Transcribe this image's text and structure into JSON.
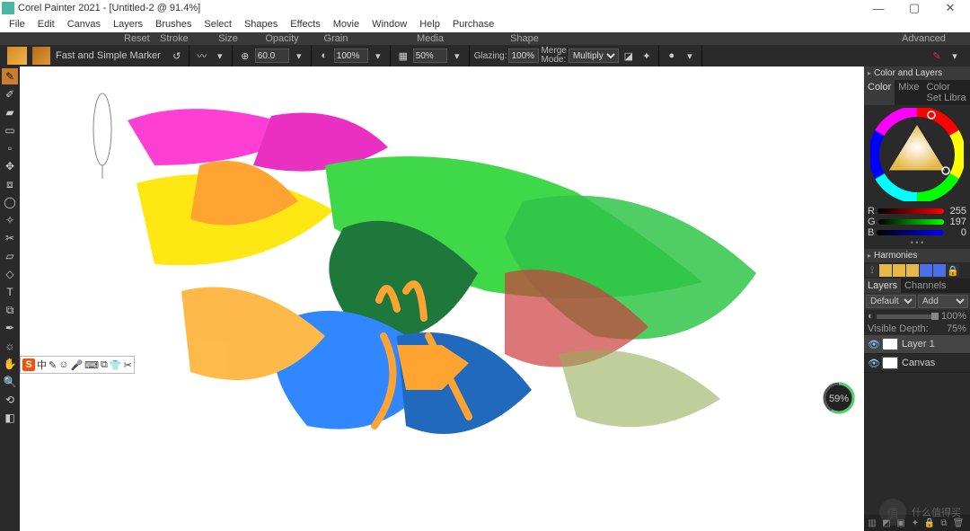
{
  "window": {
    "title": "Corel Painter 2021 - [Untitled-2 @ 91.4%]",
    "controls": {
      "min": "—",
      "max": "▢",
      "close": "✕"
    }
  },
  "menu": [
    "File",
    "Edit",
    "Canvas",
    "Layers",
    "Brushes",
    "Select",
    "Shapes",
    "Effects",
    "Movie",
    "Window",
    "Help",
    "Purchase"
  ],
  "brush": {
    "category": "Fast and Simple",
    "variant": "Marker"
  },
  "prophead": {
    "reset": "Reset",
    "stroke": "Stroke",
    "size": "Size",
    "opacity": "Opacity",
    "grain": "Grain",
    "media": "Media",
    "shape": "Shape",
    "advanced": "Advanced"
  },
  "propbar": {
    "size_value": "60.0",
    "opacity_value": "100%",
    "grain_value": "50%",
    "glazing_label": "Glazing:",
    "glazing_value": "100%",
    "merge_label": "Merge\nMode:",
    "merge_value": "Multiply"
  },
  "panels": {
    "color_and_layers": "Color and Layers",
    "color_tabs": [
      "Color",
      "Mixe",
      "Color Set Libra"
    ],
    "rgb": {
      "R": 255,
      "G": 197,
      "B": 0
    },
    "harmonies": "Harmonies",
    "harmony_swatches": [
      "#e6b84a",
      "#e6b84a",
      "#e6b84a",
      "#4a6fe6",
      "#4a6fe6"
    ],
    "layers_tab": "Layers",
    "channels_tab": "Channels",
    "blend_mode": "Default",
    "add_btn": "Add",
    "opacity_label": "",
    "opacity_value": "100%",
    "visible_depth_label": "Visible Depth:",
    "visible_depth_value": "75%",
    "layers": [
      {
        "name": "Layer 1",
        "selected": true
      },
      {
        "name": "Canvas",
        "selected": false
      }
    ]
  },
  "gauge": "59%",
  "watermark": "什么值得买",
  "ime_items": [
    "中",
    "✎",
    "☺",
    "🎤",
    "⌨",
    "⧉",
    "👕",
    "✂"
  ]
}
